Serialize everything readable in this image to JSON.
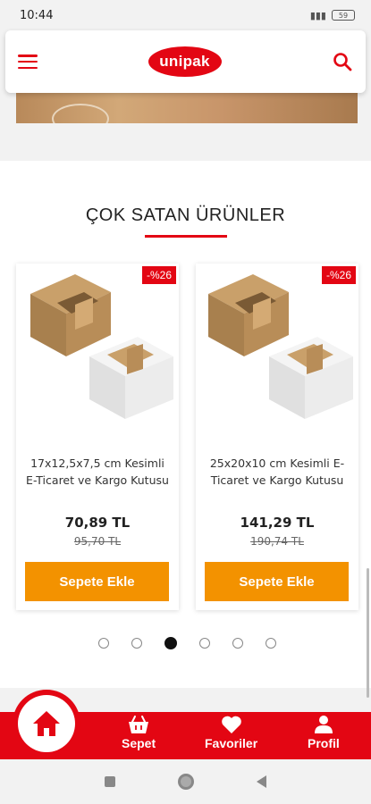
{
  "status_bar": {
    "time": "10:44",
    "battery": "59"
  },
  "header": {
    "logo_text": "unipak",
    "menu_icon": "hamburger-icon",
    "search_icon": "search-icon"
  },
  "section": {
    "title": "ÇOK SATAN ÜRÜNLER"
  },
  "products": [
    {
      "badge": "-%26",
      "name": "17x12,5x7,5 cm Kesimli E-Ticaret ve Kargo Kutusu",
      "price": "70,89 TL",
      "old_price": "95,70 TL",
      "button": "Sepete Ekle"
    },
    {
      "badge": "-%26",
      "name": "25x20x10 cm Kesimli E-Ticaret ve Kargo Kutusu",
      "price": "141,29 TL",
      "old_price": "190,74 TL",
      "button": "Sepete Ekle"
    }
  ],
  "pagination": {
    "count": 6,
    "active_index": 2
  },
  "bottom_nav": {
    "home_icon": "home-icon",
    "cart_label": "Sepet",
    "favorites_label": "Favoriler",
    "profile_label": "Profil"
  },
  "colors": {
    "brand_red": "#e30613",
    "button_orange": "#f39200"
  }
}
